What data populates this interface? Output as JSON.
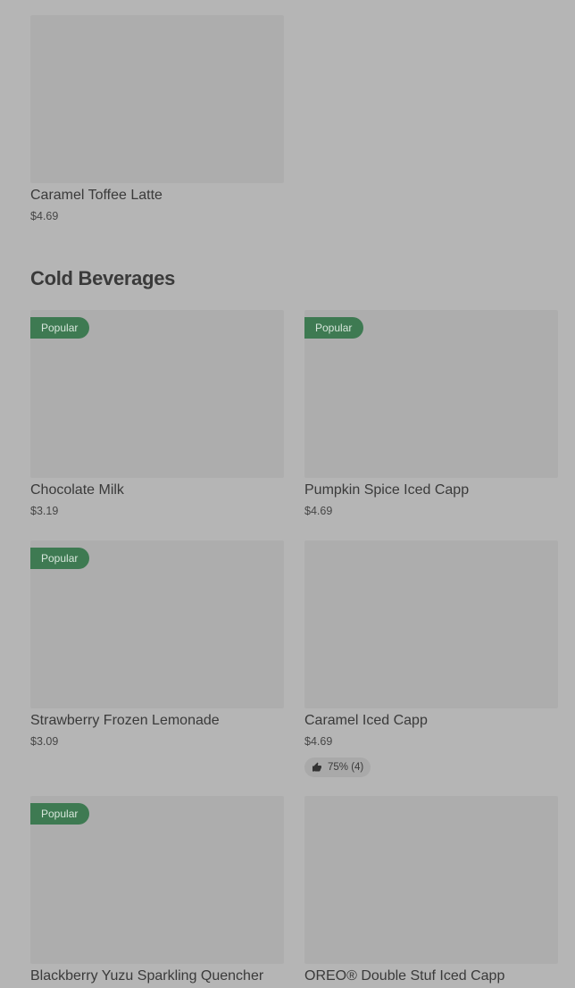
{
  "top_item": {
    "name": "Caramel Toffee Latte",
    "price": "$4.69"
  },
  "section": {
    "title": "Cold Beverages"
  },
  "products": [
    {
      "name": "Chocolate Milk",
      "price": "$3.19",
      "badge": "Popular"
    },
    {
      "name": "Pumpkin Spice Iced Capp",
      "price": "$4.69",
      "badge": "Popular"
    },
    {
      "name": "Strawberry Frozen Lemonade",
      "price": "$3.09",
      "badge": "Popular"
    },
    {
      "name": "Caramel Iced Capp",
      "price": "$4.69",
      "rating": "75% (4)",
      "rating_icon": "thumbs-up-icon"
    },
    {
      "name": "Blackberry Yuzu Sparkling Quencher",
      "badge": "Popular"
    },
    {
      "name": "OREO® Double Stuf Iced Capp"
    }
  ],
  "colors": {
    "background": "#b5b5b5",
    "image_placeholder": "#adadad",
    "badge": "#3e7a52",
    "text": "#3a3a3a"
  }
}
